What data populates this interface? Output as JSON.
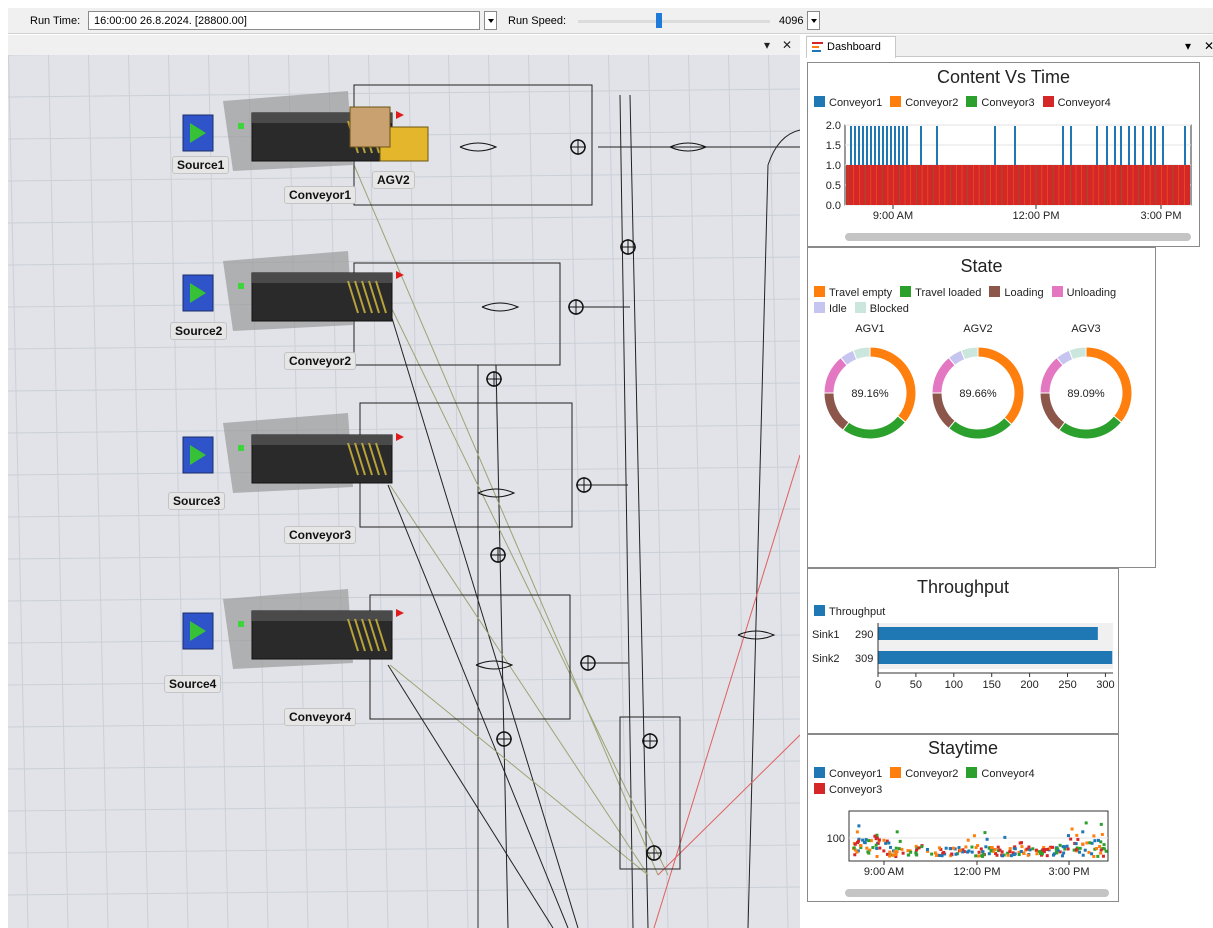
{
  "toolbar": {
    "run_time_label": "Run Time:",
    "run_time_value": "16:00:00  26.8.2024.  [28800.00]",
    "run_speed_label": "Run Speed:",
    "run_speed_value": "4096",
    "view_pin": "▾",
    "view_close": "✕"
  },
  "dashboard_tab": {
    "label": "Dashboard",
    "pin": "▾",
    "close": "✕"
  },
  "scene": {
    "sources": [
      "Source1",
      "Source2",
      "Source3",
      "Source4"
    ],
    "conveyors": [
      "Conveyor1",
      "Conveyor2",
      "Conveyor3",
      "Conveyor4"
    ],
    "agv_label": "AGV2"
  },
  "content_vs_time": {
    "title": "Content Vs Time",
    "legend": [
      {
        "name": "Conveyor1",
        "color": "#1f77b4"
      },
      {
        "name": "Conveyor2",
        "color": "#ff7f0e"
      },
      {
        "name": "Conveyor3",
        "color": "#2ca02c"
      },
      {
        "name": "Conveyor4",
        "color": "#d62728"
      }
    ],
    "y_ticks": [
      "2.0",
      "1.5",
      "1.0",
      "0.5",
      "0.0"
    ],
    "x_ticks": [
      "9:00 AM",
      "12:00 PM",
      "3:00 PM"
    ]
  },
  "state": {
    "title": "State",
    "legend": [
      {
        "name": "Travel empty",
        "color": "#ff7f0e"
      },
      {
        "name": "Travel loaded",
        "color": "#2ca02c"
      },
      {
        "name": "Loading",
        "color": "#8c564b"
      },
      {
        "name": "Unloading",
        "color": "#e377c2"
      },
      {
        "name": "Idle",
        "color": "#c5c5ef"
      },
      {
        "name": "Blocked",
        "color": "#cbe6dd"
      }
    ],
    "agvs": [
      {
        "name": "AGV1",
        "value_label": "89.16%"
      },
      {
        "name": "AGV2",
        "value_label": "89.66%"
      },
      {
        "name": "AGV3",
        "value_label": "89.09%"
      }
    ]
  },
  "throughput": {
    "title": "Throughput",
    "legend": [
      {
        "name": "Throughput",
        "color": "#1f77b4"
      }
    ],
    "x_ticks": [
      "0",
      "50",
      "100",
      "150",
      "200",
      "250",
      "300"
    ]
  },
  "staytime": {
    "title": "Staytime",
    "legend": [
      {
        "name": "Conveyor1",
        "color": "#1f77b4"
      },
      {
        "name": "Conveyor2",
        "color": "#ff7f0e"
      },
      {
        "name": "Conveyor4",
        "color": "#2ca02c"
      },
      {
        "name": "Conveyor3",
        "color": "#d62728"
      }
    ],
    "y_tick": "100",
    "x_ticks": [
      "9:00 AM",
      "12:00 PM",
      "3:00 PM"
    ]
  },
  "chart_data": [
    {
      "type": "bar",
      "title": "Content Vs Time",
      "series": [
        {
          "name": "Conveyor4",
          "values": [
            1
          ]
        },
        {
          "name": "Conveyor1",
          "values": [
            2
          ]
        }
      ],
      "ylim": [
        0,
        2
      ],
      "x_range": [
        "8:00 AM",
        "4:00 PM"
      ]
    },
    {
      "type": "pie",
      "title": "State",
      "charts": [
        {
          "name": "AGV1",
          "label": "89.16%",
          "slices": {
            "Travel empty": 36,
            "Travel loaded": 24,
            "Loading": 15,
            "Unloading": 14,
            "Idle": 5,
            "Blocked": 6
          }
        },
        {
          "name": "AGV2",
          "label": "89.66%",
          "slices": {
            "Travel empty": 37,
            "Travel loaded": 24,
            "Loading": 14,
            "Unloading": 14,
            "Idle": 5,
            "Blocked": 6
          }
        },
        {
          "name": "AGV3",
          "label": "89.09%",
          "slices": {
            "Travel empty": 36,
            "Travel loaded": 24,
            "Loading": 15,
            "Unloading": 14,
            "Idle": 5,
            "Blocked": 6
          }
        }
      ]
    },
    {
      "type": "bar",
      "title": "Throughput",
      "categories": [
        "Sink1",
        "Sink2"
      ],
      "values": [
        290,
        309
      ],
      "xlim": [
        0,
        310
      ]
    },
    {
      "type": "scatter",
      "title": "Staytime",
      "series": [
        {
          "name": "Conveyor1"
        },
        {
          "name": "Conveyor2"
        },
        {
          "name": "Conveyor4"
        },
        {
          "name": "Conveyor3"
        }
      ],
      "y_tick": 100,
      "x_range": [
        "8:00 AM",
        "4:00 PM"
      ]
    }
  ]
}
